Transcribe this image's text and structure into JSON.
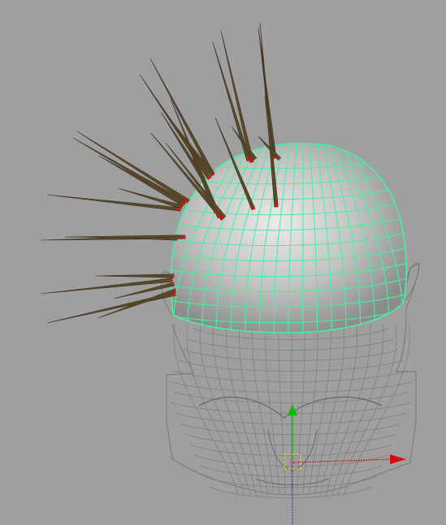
{
  "viewport": {
    "background_color": "#9f9f9f",
    "wire_color": "#7f7f7f",
    "selection_wire_color": "#47f0a0",
    "spike_color": "#5b4a2a",
    "spike_tip_color": "#d01a12"
  },
  "manipulator": {
    "x_axis_color": "#c01010",
    "y_axis_color": "#12b812",
    "z_axis_color": "#2828c0",
    "pivot_color": "#e8d818",
    "icons": [
      "translate-x-arrow-icon",
      "translate-y-arrow-icon",
      "pivot-square-icon"
    ]
  }
}
